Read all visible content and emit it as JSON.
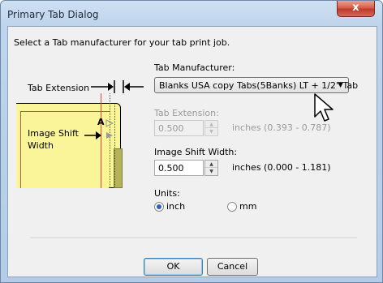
{
  "window": {
    "title": "Primary Tab Dialog",
    "close_glyph": "x"
  },
  "instruction": "Select a Tab manufacturer for your tab print job.",
  "diagram": {
    "tab_extension_label": "Tab Extension",
    "image_shift_label_line1": "Image Shift",
    "image_shift_label_line2": "Width",
    "marker_a": "A"
  },
  "tab_manufacturer": {
    "label": "Tab Manufacturer:",
    "value": "Blanks USA copy Tabs(5Banks) LT + 1/2\" Tab"
  },
  "tab_extension": {
    "label": "Tab Extension:",
    "value": "0.500",
    "range": "inches (0.393 - 0.787)",
    "enabled": false
  },
  "image_shift_width": {
    "label": "Image Shift Width:",
    "value": "0.500",
    "range": "inches (0.000 - 1.181)"
  },
  "units": {
    "label": "Units:",
    "options": [
      {
        "label": "inch",
        "selected": true
      },
      {
        "label": "mm",
        "selected": false
      }
    ]
  },
  "buttons": {
    "ok": "OK",
    "cancel": "Cancel"
  },
  "colors": {
    "paper": "#fbf59a",
    "guide_red": "#d94b3c",
    "tab_green": "#b5b35a",
    "close_red": "#c0392b"
  }
}
